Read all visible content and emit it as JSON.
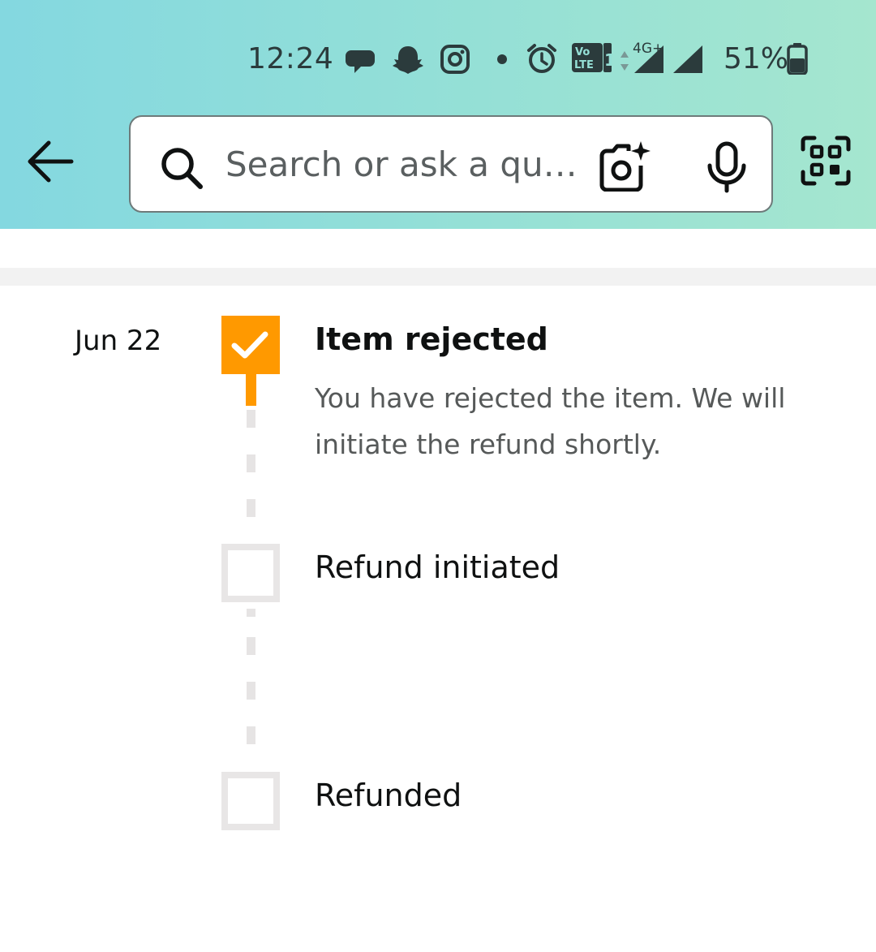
{
  "status_bar": {
    "time": "12:24",
    "network": "4G+",
    "battery": "51%",
    "icons": [
      "chat-bubble-icon",
      "snapchat-icon",
      "instagram-icon",
      "dot-icon",
      "alarm-icon",
      "volte-icon",
      "signal-icon",
      "battery-icon"
    ]
  },
  "header": {
    "back_icon": "arrow-left-icon",
    "search_placeholder": "Search or ask a qu…",
    "camera_icon": "camera-sparkle-icon",
    "mic_icon": "microphone-icon",
    "scan_icon": "qr-scan-icon"
  },
  "timeline": {
    "accent_color": "#ff9900",
    "pending_color": "#e8e6e6",
    "steps": [
      {
        "date": "Jun 22",
        "title": "Item rejected",
        "description": "You have rejected the item. We will initiate the refund shortly.",
        "status": "done"
      },
      {
        "date": "",
        "title": "Refund initiated",
        "description": "",
        "status": "pending"
      },
      {
        "date": "",
        "title": "Refunded",
        "description": "",
        "status": "pending"
      }
    ]
  }
}
